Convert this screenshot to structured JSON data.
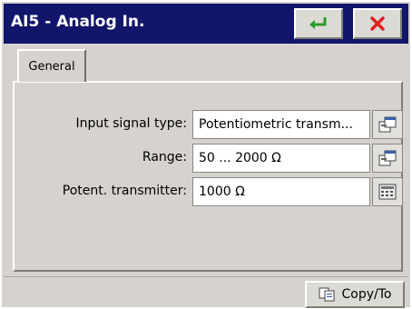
{
  "window": {
    "title": "AI5 - Analog In.",
    "ok_icon": "enter-arrow-icon",
    "close_icon": "close-icon"
  },
  "tabs": [
    {
      "label": "General",
      "selected": true
    }
  ],
  "fields": [
    {
      "label": "Input signal type:",
      "value": "Potentiometric transm...",
      "button_icon": "select-dropdown-icon"
    },
    {
      "label": "Range:",
      "value": "50 ... 2000 Ω",
      "button_icon": "select-dropdown-icon"
    },
    {
      "label": "Potent. transmitter:",
      "value": "1000 Ω",
      "button_icon": "keypad-icon"
    }
  ],
  "footer": {
    "copy_label": "Copy/To",
    "copy_icon": "copy-icon"
  },
  "colors": {
    "titlebar": "#12166b",
    "window_bg": "#d6d3ce",
    "ok_green": "#2e9a2e",
    "close_red": "#e02020"
  }
}
